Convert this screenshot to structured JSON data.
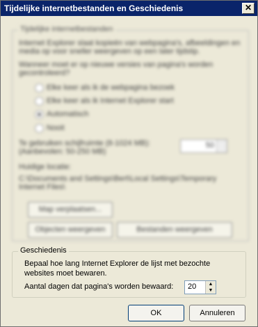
{
  "window": {
    "title": "Tijdelijke internetbestanden en Geschiedenis",
    "close_glyph": "✕"
  },
  "temp_files": {
    "legend": "Tijdelijke internetbestanden",
    "description": "Internet Explorer slaat kopieën van webpagina's, afbeeldingen en media op voor sneller weergeven op een later tijdstip.",
    "check_question": "Wanneer moet er op nieuwe versies van pagina's worden gecontroleerd?",
    "options": [
      {
        "label": "Elke keer als ik de webpagina bezoek",
        "selected": false
      },
      {
        "label": "Elke keer als ik Internet Explorer start",
        "selected": false
      },
      {
        "label": "Automatisch",
        "selected": true
      },
      {
        "label": "Nooit",
        "selected": false
      }
    ],
    "disk_space_label": "Te gebruiken schijfruimte (8-1024 MB): (Aanbevolen: 50-250 MB)",
    "disk_space_value": "50",
    "location_label": "Huidige locatie:",
    "location_path": "C:\\Documents and Settings\\Bert\\Local Settings\\Temporary Internet Files\\",
    "move_button": "Map verplaatsen...",
    "view_objects_button": "Objecten weergeven",
    "view_files_button": "Bestanden weergeven"
  },
  "history": {
    "legend": "Geschiedenis",
    "description": "Bepaal hoe lang Internet Explorer de lijst met bezochte websites moet bewaren.",
    "days_label": "Aantal dagen dat pagina's worden bewaard:",
    "days_value": "20"
  },
  "footer": {
    "ok": "OK",
    "cancel": "Annuleren"
  }
}
